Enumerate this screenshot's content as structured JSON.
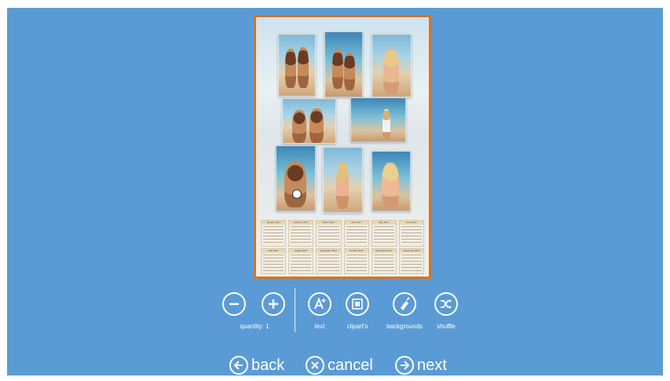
{
  "toolbar": {
    "quantity_label": "quantity: 1",
    "text_label": "text",
    "cliparts_label": "clipart's",
    "backgrounds_label": "backgrounds",
    "shuffle_label": "shuffle"
  },
  "nav": {
    "back_label": "back",
    "cancel_label": "cancel",
    "next_label": "next"
  },
  "calendar": {
    "months": [
      "January 2017",
      "February 2017",
      "March 2017",
      "April 2017",
      "May 2017",
      "June 2017",
      "July 2017",
      "August 2017",
      "September 2017",
      "October 2017",
      "November 2017",
      "December 2017"
    ]
  },
  "icons": {
    "minus": "minus-icon",
    "plus": "plus-icon",
    "text": "text-add-icon",
    "clipart": "clipart-icon",
    "backgrounds": "brush-icon",
    "shuffle": "shuffle-icon",
    "back": "arrow-left-icon",
    "cancel": "close-icon",
    "next": "arrow-right-icon"
  },
  "colors": {
    "background": "#5b9bd5",
    "collage_border": "#d3742a",
    "toolbar_foreground": "#ffffff"
  }
}
